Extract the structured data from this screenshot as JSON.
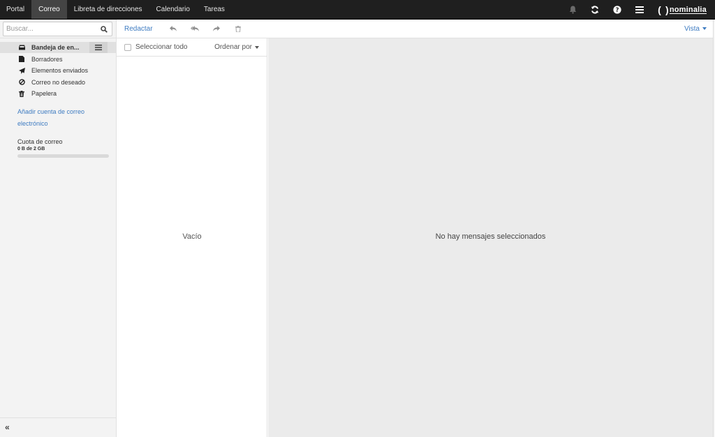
{
  "topbar": {
    "nav": [
      "Portal",
      "Correo",
      "Libreta de direcciones",
      "Calendario",
      "Tareas"
    ],
    "active_nav": "Correo",
    "icons": [
      "bell-icon",
      "refresh-icon",
      "help-icon",
      "menu-icon"
    ],
    "brand": {
      "open": "(",
      "close": ")",
      "name": "nominalia"
    }
  },
  "search": {
    "placeholder": "Buscar..."
  },
  "folders": [
    {
      "label": "Bandeja de en...",
      "icon": "inbox-icon",
      "active": true
    },
    {
      "label": "Borradores",
      "icon": "draft-icon"
    },
    {
      "label": "Elementos enviados",
      "icon": "send-icon"
    },
    {
      "label": "Correo no deseado",
      "icon": "ban-icon"
    },
    {
      "label": "Papelera",
      "icon": "trash-icon"
    }
  ],
  "sidebar": {
    "add_account": "Añadir cuenta de correo electrónico",
    "quota_label": "Cuota de correo",
    "quota_value": "0 B de 2 GB",
    "quota_fraction": 0,
    "collapse": "«"
  },
  "toolbar": {
    "compose": "Redactar",
    "icons": [
      "reply-icon",
      "reply-all-icon",
      "forward-icon",
      "delete-icon"
    ],
    "view": "Vista"
  },
  "list": {
    "select_all": "Seleccionar todo",
    "sort": "Ordenar por",
    "empty": "Vacío"
  },
  "preview": {
    "empty": "No hay mensajes seleccionados"
  },
  "colors": {
    "link": "#3f7cc1",
    "topbar": "#1f1f1f",
    "active_tab": "#444444",
    "preview_bg": "#ebebeb"
  }
}
